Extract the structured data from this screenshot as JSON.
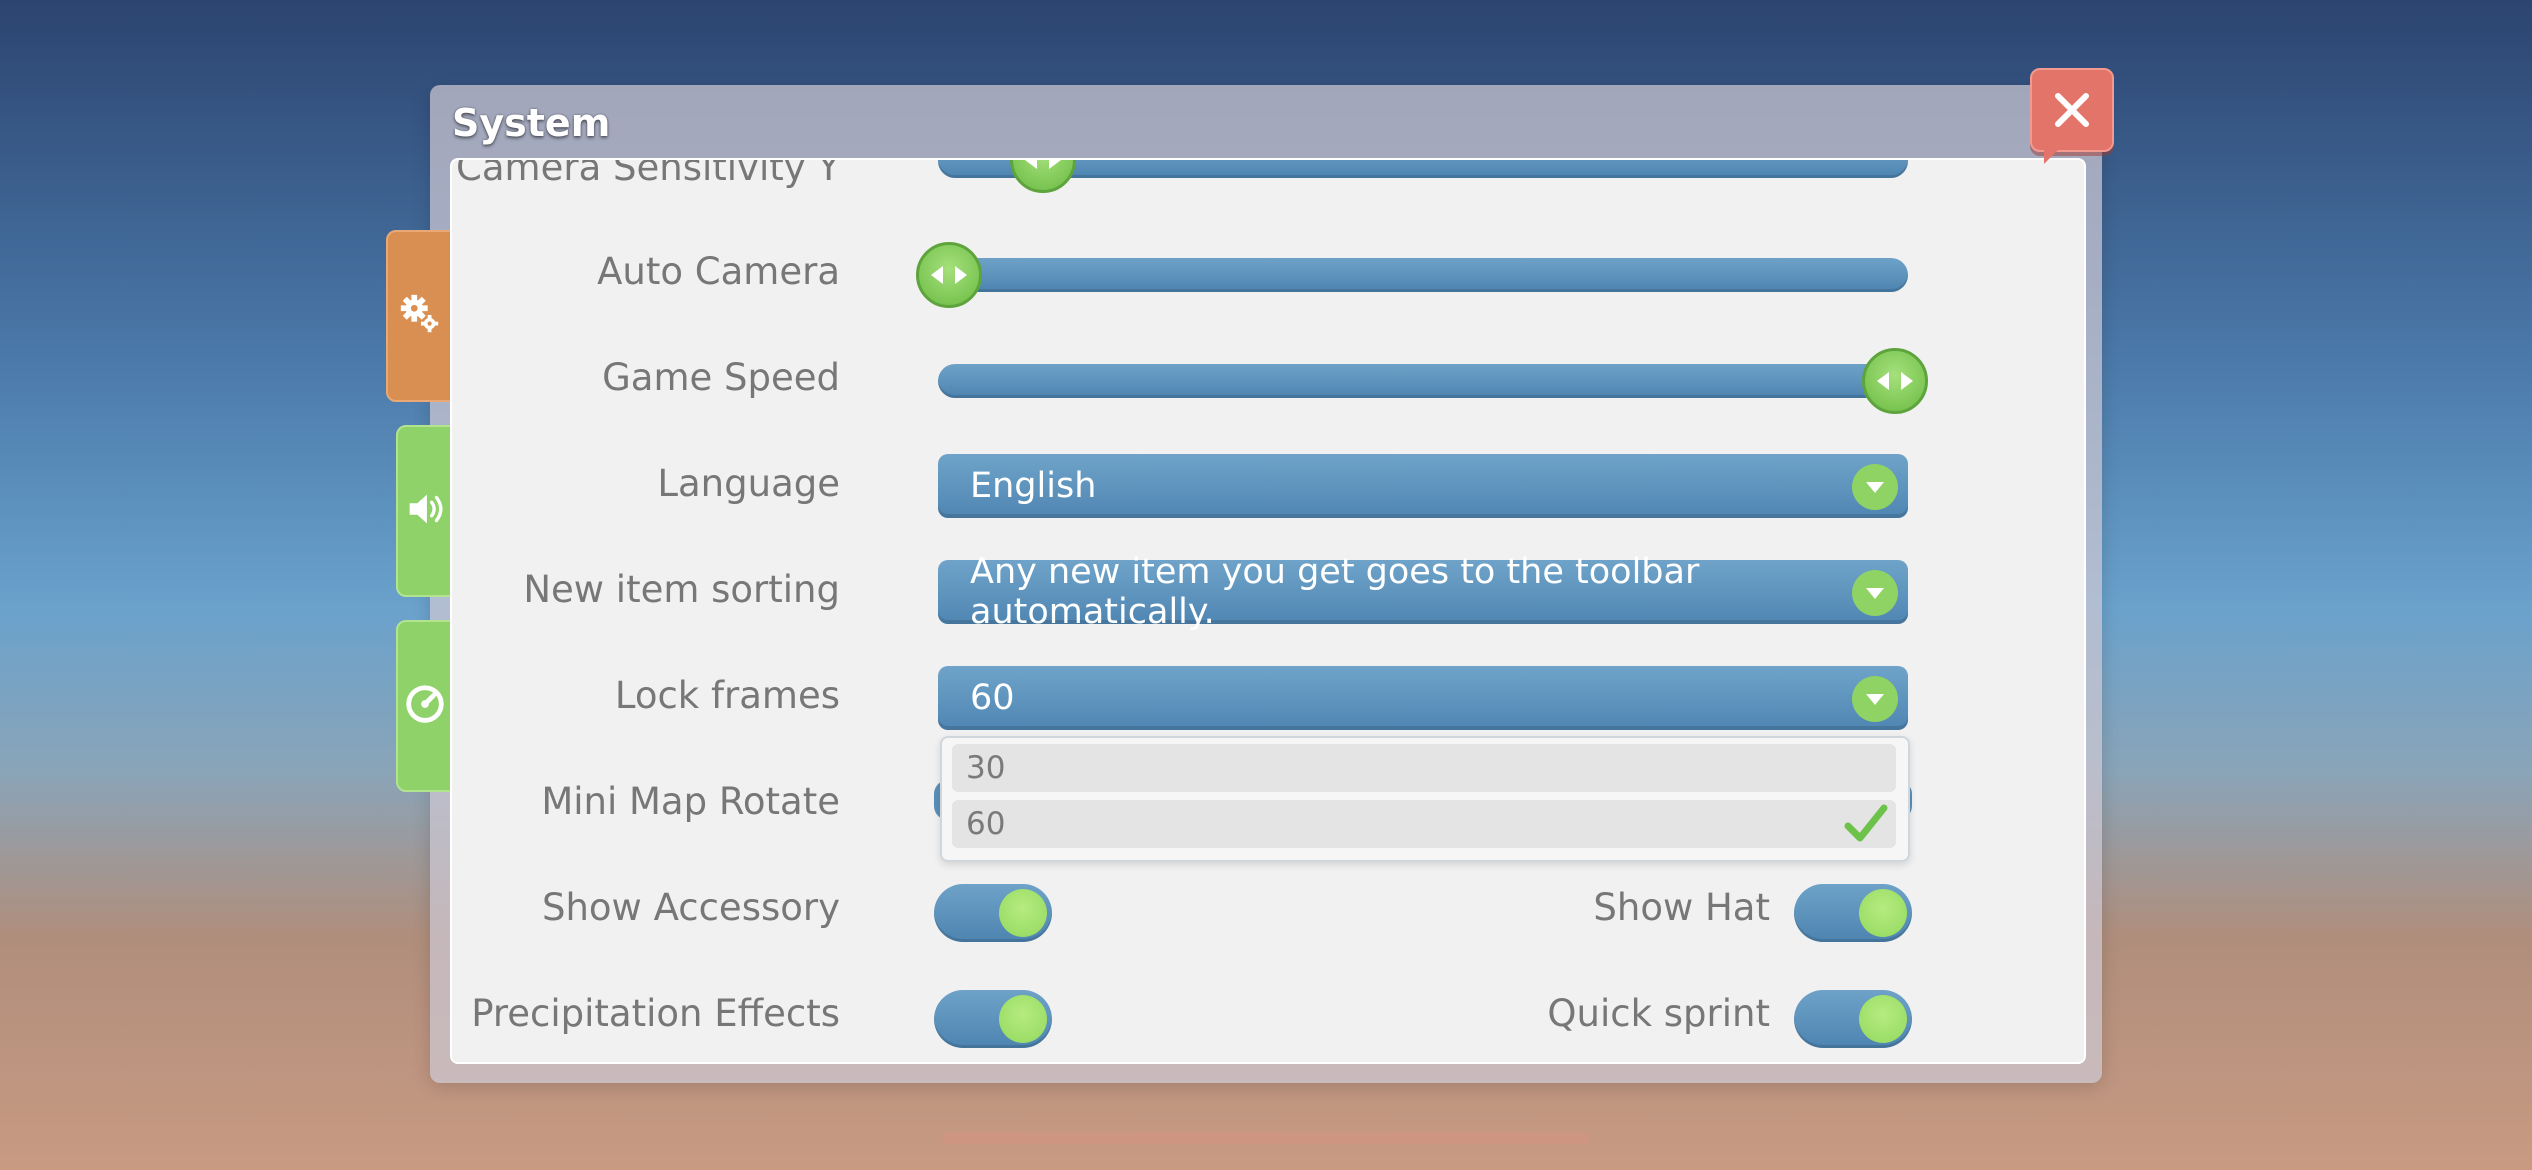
{
  "window": {
    "title": "System"
  },
  "tabs": [
    {
      "name": "general",
      "icon": "gears-icon",
      "active": true
    },
    {
      "name": "sound",
      "icon": "speaker-icon",
      "active": false
    },
    {
      "name": "performance",
      "icon": "speedometer-icon",
      "active": false
    }
  ],
  "settings": {
    "camera_sensitivity_y": {
      "label": "Camera Sensitivity Y",
      "value": 0.07
    },
    "auto_camera": {
      "label": "Auto Camera",
      "value": 0.0
    },
    "game_speed": {
      "label": "Game Speed",
      "value": 1.0
    },
    "language": {
      "label": "Language",
      "value": "English"
    },
    "new_item_sorting": {
      "label": "New item sorting",
      "value": "Any new item you get goes to the toolbar automatically."
    },
    "lock_frames": {
      "label": "Lock frames",
      "value": "60",
      "options": [
        "30",
        "60"
      ],
      "selected": "60"
    },
    "mini_map_rotate": {
      "label": "Mini Map Rotate"
    },
    "show_accessory": {
      "label": "Show Accessory",
      "on": true
    },
    "show_hat": {
      "label": "Show Hat",
      "on": true
    },
    "precipitation_effects": {
      "label": "Precipitation Effects",
      "on": true
    },
    "quick_sprint": {
      "label": "Quick sprint",
      "on": true
    }
  },
  "colors": {
    "accent_blue": "#4f86b2",
    "accent_green": "#7cc654",
    "tab_orange": "#d98e52",
    "close_red": "#e3746a"
  }
}
